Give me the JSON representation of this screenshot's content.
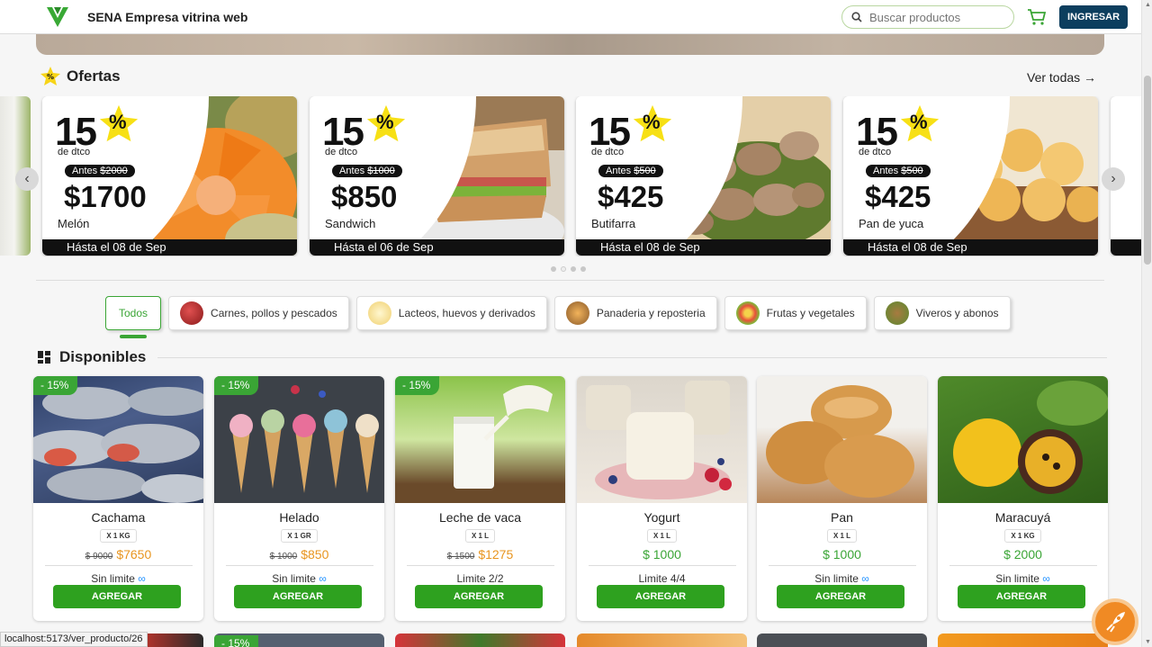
{
  "header": {
    "brand": "SENA Empresa vitrina web",
    "search_placeholder": "Buscar productos",
    "login_label": "INGRESAR"
  },
  "ofertas": {
    "title": "Ofertas",
    "see_all": "Ver todas →",
    "cards": [
      {
        "pct": "15",
        "pct_sign": "%",
        "dtco": "de dtco",
        "antes": "Antes",
        "old_price": "$2000",
        "price": "$1700",
        "name": "Melón",
        "until": "Hásta el 08 de Sep"
      },
      {
        "pct": "15",
        "pct_sign": "%",
        "dtco": "de dtco",
        "antes": "Antes",
        "old_price": "$1000",
        "price": "$850",
        "name": "Sandwich",
        "until": "Hásta el 06 de Sep"
      },
      {
        "pct": "15",
        "pct_sign": "%",
        "dtco": "de dtco",
        "antes": "Antes",
        "old_price": "$500",
        "price": "$425",
        "name": "Butifarra",
        "until": "Hásta el 08 de Sep"
      },
      {
        "pct": "15",
        "pct_sign": "%",
        "dtco": "de dtco",
        "antes": "Antes",
        "old_price": "$500",
        "price": "$425",
        "name": "Pan de yuca",
        "until": "Hásta el 08 de Sep"
      }
    ]
  },
  "categories": [
    {
      "label": "Todos"
    },
    {
      "label": "Carnes, pollos y pescados"
    },
    {
      "label": "Lacteos, huevos y derivados"
    },
    {
      "label": "Panaderia y reposteria"
    },
    {
      "label": "Frutas y vegetales"
    },
    {
      "label": "Viveros y abonos"
    }
  ],
  "disponibles": {
    "title": "Disponibles",
    "add_label": "AGREGAR",
    "products": [
      {
        "name": "Cachama",
        "unit": "X 1 KG",
        "discount": "- 15%",
        "old_price": "$ 9000",
        "price": "$7650",
        "limit": "Sin limite",
        "infinite": "∞"
      },
      {
        "name": "Helado",
        "unit": "X 1 GR",
        "discount": "- 15%",
        "old_price": "$ 1000",
        "price": "$850",
        "limit": "Sin limite",
        "infinite": "∞"
      },
      {
        "name": "Leche de vaca",
        "unit": "X 1 L",
        "discount": "- 15%",
        "old_price": "$ 1500",
        "price": "$1275",
        "limit": "Limite 2/2",
        "infinite": ""
      },
      {
        "name": "Yogurt",
        "unit": "X 1 L",
        "discount": "",
        "old_price": "",
        "price": "$ 1000",
        "limit": "Limite 4/4",
        "infinite": ""
      },
      {
        "name": "Pan",
        "unit": "X 1 L",
        "discount": "",
        "old_price": "",
        "price": "$ 1000",
        "limit": "Sin limite",
        "infinite": "∞"
      },
      {
        "name": "Maracuyá",
        "unit": "X 1 KG",
        "discount": "",
        "old_price": "",
        "price": "$ 2000",
        "limit": "Sin limite",
        "infinite": "∞"
      }
    ],
    "row2_discount": "- 15%"
  },
  "status_url": "localhost:5173/ver_producto/26",
  "colors": {
    "accent": "#3aa535",
    "login": "#0c3e5e",
    "offer_price": "#e8951f"
  }
}
